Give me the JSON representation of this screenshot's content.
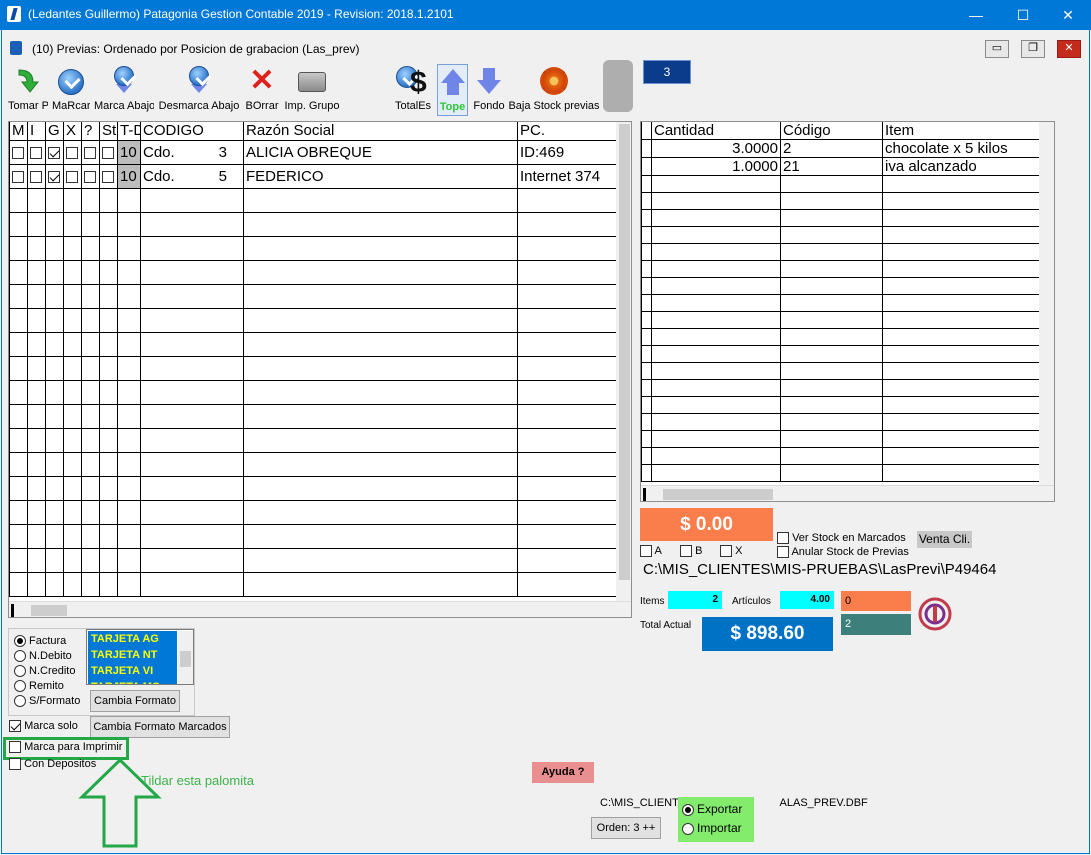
{
  "window": {
    "title": "(Ledantes Guillermo) Patagonia Gestion Contable 2019 - Revision: 2018.1.2101",
    "minimize": "—",
    "maximize": "☐",
    "close": "✕"
  },
  "child": {
    "title": "(10) Previas: Ordenado por Posicion de grabacion (Las_prev)",
    "btn_min": "▭",
    "btn_restore": "❐",
    "btn_close": "✕"
  },
  "toolbar": {
    "tomar": "Tomar P",
    "marcar": "MaRcar",
    "marca_abajo": "Marca Abajo",
    "desmarca_abajo": "Desmarca Abajo",
    "borrar": "BOrrar",
    "imp_grupo": "Imp. Grupo",
    "totales": "TotalEs",
    "tope": "Tope",
    "fondo": "Fondo",
    "baja_stock": "Baja Stock previas",
    "counter": "3",
    "dollar_glyph": "$",
    "x_glyph": "✕"
  },
  "left_grid": {
    "headers": [
      "M",
      "I",
      "G",
      "X",
      "?",
      "St",
      "T-D",
      "CODIGO",
      "Razón Social",
      "PC."
    ],
    "rows": [
      {
        "m": false,
        "i": false,
        "g": true,
        "x": false,
        "q": false,
        "st": false,
        "td": "10",
        "tipo": "Cdo.",
        "codigo": "3",
        "razon": "ALICIA OBREQUE",
        "pc": "ID:469"
      },
      {
        "m": false,
        "i": false,
        "g": true,
        "x": false,
        "q": false,
        "st": false,
        "td": "10",
        "tipo": "Cdo.",
        "codigo": "5",
        "razon": "FEDERICO",
        "pc": "Internet 374"
      }
    ]
  },
  "right_grid": {
    "headers": [
      "Cantidad",
      "Código",
      "Item"
    ],
    "rows": [
      {
        "cantidad": "3.0000",
        "codigo": "2",
        "item": "chocolate x 5 kilos"
      },
      {
        "cantidad": "1.0000",
        "codigo": "21",
        "item": "iva alcanzado"
      }
    ]
  },
  "summary": {
    "total_selected": "$    0.00",
    "chk_a": "A",
    "chk_b": "B",
    "chk_x": "X",
    "ver_stock": "Ver Stock en Marcados",
    "anular_stock": "Anular Stock de Previas",
    "venta_cli": "Venta Cli.",
    "path": "C:\\MIS_CLIENTES\\MIS-PRUEBAS\\LasPrevi\\P49464",
    "items_label": "Items",
    "items_value": "2",
    "articulos_label": "Artículos",
    "articulos_value": "4.00",
    "total_actual_label": "Total Actual",
    "total_actual_value": "$  898.60",
    "orange_value": "0",
    "teal_value": "2"
  },
  "format": {
    "options": [
      "Factura",
      "N.Debito",
      "N.Credito",
      "Remito",
      "S/Formato"
    ],
    "selected": "Factura",
    "cards": [
      "TARJETA AG",
      "TARJETA NT",
      "TARJETA VI",
      "TARJETA MC"
    ],
    "cambia_formato": "Cambia Formato",
    "cambia_formato_marcados": "Cambia Formato Marcados",
    "marca_solo": "Marca solo",
    "marca_imprimir": "Marca para Imprimir",
    "con_depositos": "Con Depositos"
  },
  "annotation": {
    "note": "Tildar esta palomita",
    "accent": "#22a847"
  },
  "footer": {
    "ayuda": "Ayuda ?",
    "path_prefix": "C:\\MIS_CLIENTES",
    "path_suffix": "ALAS_PREV.DBF",
    "exportar": "Exportar",
    "importar": "Importar",
    "orden": "Orden: 3 ++"
  }
}
